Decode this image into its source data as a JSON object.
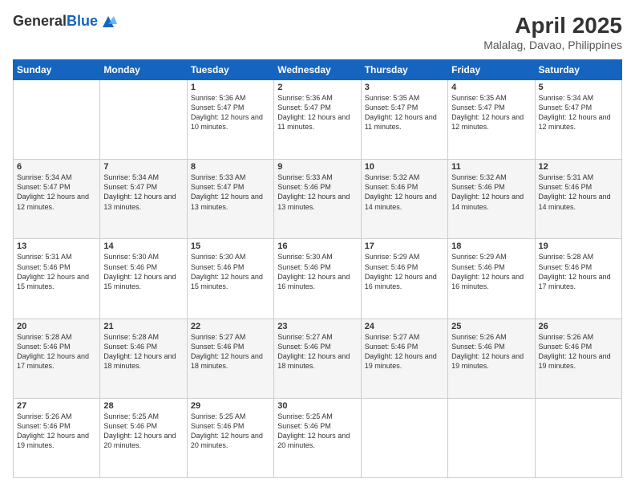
{
  "header": {
    "logo_general": "General",
    "logo_blue": "Blue",
    "title": "April 2025",
    "location": "Malalag, Davao, Philippines"
  },
  "weekdays": [
    "Sunday",
    "Monday",
    "Tuesday",
    "Wednesday",
    "Thursday",
    "Friday",
    "Saturday"
  ],
  "weeks": [
    [
      {
        "day": "",
        "info": ""
      },
      {
        "day": "",
        "info": ""
      },
      {
        "day": "1",
        "info": "Sunrise: 5:36 AM\nSunset: 5:47 PM\nDaylight: 12 hours and 10 minutes."
      },
      {
        "day": "2",
        "info": "Sunrise: 5:36 AM\nSunset: 5:47 PM\nDaylight: 12 hours and 11 minutes."
      },
      {
        "day": "3",
        "info": "Sunrise: 5:35 AM\nSunset: 5:47 PM\nDaylight: 12 hours and 11 minutes."
      },
      {
        "day": "4",
        "info": "Sunrise: 5:35 AM\nSunset: 5:47 PM\nDaylight: 12 hours and 12 minutes."
      },
      {
        "day": "5",
        "info": "Sunrise: 5:34 AM\nSunset: 5:47 PM\nDaylight: 12 hours and 12 minutes."
      }
    ],
    [
      {
        "day": "6",
        "info": "Sunrise: 5:34 AM\nSunset: 5:47 PM\nDaylight: 12 hours and 12 minutes."
      },
      {
        "day": "7",
        "info": "Sunrise: 5:34 AM\nSunset: 5:47 PM\nDaylight: 12 hours and 13 minutes."
      },
      {
        "day": "8",
        "info": "Sunrise: 5:33 AM\nSunset: 5:47 PM\nDaylight: 12 hours and 13 minutes."
      },
      {
        "day": "9",
        "info": "Sunrise: 5:33 AM\nSunset: 5:46 PM\nDaylight: 12 hours and 13 minutes."
      },
      {
        "day": "10",
        "info": "Sunrise: 5:32 AM\nSunset: 5:46 PM\nDaylight: 12 hours and 14 minutes."
      },
      {
        "day": "11",
        "info": "Sunrise: 5:32 AM\nSunset: 5:46 PM\nDaylight: 12 hours and 14 minutes."
      },
      {
        "day": "12",
        "info": "Sunrise: 5:31 AM\nSunset: 5:46 PM\nDaylight: 12 hours and 14 minutes."
      }
    ],
    [
      {
        "day": "13",
        "info": "Sunrise: 5:31 AM\nSunset: 5:46 PM\nDaylight: 12 hours and 15 minutes."
      },
      {
        "day": "14",
        "info": "Sunrise: 5:30 AM\nSunset: 5:46 PM\nDaylight: 12 hours and 15 minutes."
      },
      {
        "day": "15",
        "info": "Sunrise: 5:30 AM\nSunset: 5:46 PM\nDaylight: 12 hours and 15 minutes."
      },
      {
        "day": "16",
        "info": "Sunrise: 5:30 AM\nSunset: 5:46 PM\nDaylight: 12 hours and 16 minutes."
      },
      {
        "day": "17",
        "info": "Sunrise: 5:29 AM\nSunset: 5:46 PM\nDaylight: 12 hours and 16 minutes."
      },
      {
        "day": "18",
        "info": "Sunrise: 5:29 AM\nSunset: 5:46 PM\nDaylight: 12 hours and 16 minutes."
      },
      {
        "day": "19",
        "info": "Sunrise: 5:28 AM\nSunset: 5:46 PM\nDaylight: 12 hours and 17 minutes."
      }
    ],
    [
      {
        "day": "20",
        "info": "Sunrise: 5:28 AM\nSunset: 5:46 PM\nDaylight: 12 hours and 17 minutes."
      },
      {
        "day": "21",
        "info": "Sunrise: 5:28 AM\nSunset: 5:46 PM\nDaylight: 12 hours and 18 minutes."
      },
      {
        "day": "22",
        "info": "Sunrise: 5:27 AM\nSunset: 5:46 PM\nDaylight: 12 hours and 18 minutes."
      },
      {
        "day": "23",
        "info": "Sunrise: 5:27 AM\nSunset: 5:46 PM\nDaylight: 12 hours and 18 minutes."
      },
      {
        "day": "24",
        "info": "Sunrise: 5:27 AM\nSunset: 5:46 PM\nDaylight: 12 hours and 19 minutes."
      },
      {
        "day": "25",
        "info": "Sunrise: 5:26 AM\nSunset: 5:46 PM\nDaylight: 12 hours and 19 minutes."
      },
      {
        "day": "26",
        "info": "Sunrise: 5:26 AM\nSunset: 5:46 PM\nDaylight: 12 hours and 19 minutes."
      }
    ],
    [
      {
        "day": "27",
        "info": "Sunrise: 5:26 AM\nSunset: 5:46 PM\nDaylight: 12 hours and 19 minutes."
      },
      {
        "day": "28",
        "info": "Sunrise: 5:25 AM\nSunset: 5:46 PM\nDaylight: 12 hours and 20 minutes."
      },
      {
        "day": "29",
        "info": "Sunrise: 5:25 AM\nSunset: 5:46 PM\nDaylight: 12 hours and 20 minutes."
      },
      {
        "day": "30",
        "info": "Sunrise: 5:25 AM\nSunset: 5:46 PM\nDaylight: 12 hours and 20 minutes."
      },
      {
        "day": "",
        "info": ""
      },
      {
        "day": "",
        "info": ""
      },
      {
        "day": "",
        "info": ""
      }
    ]
  ]
}
